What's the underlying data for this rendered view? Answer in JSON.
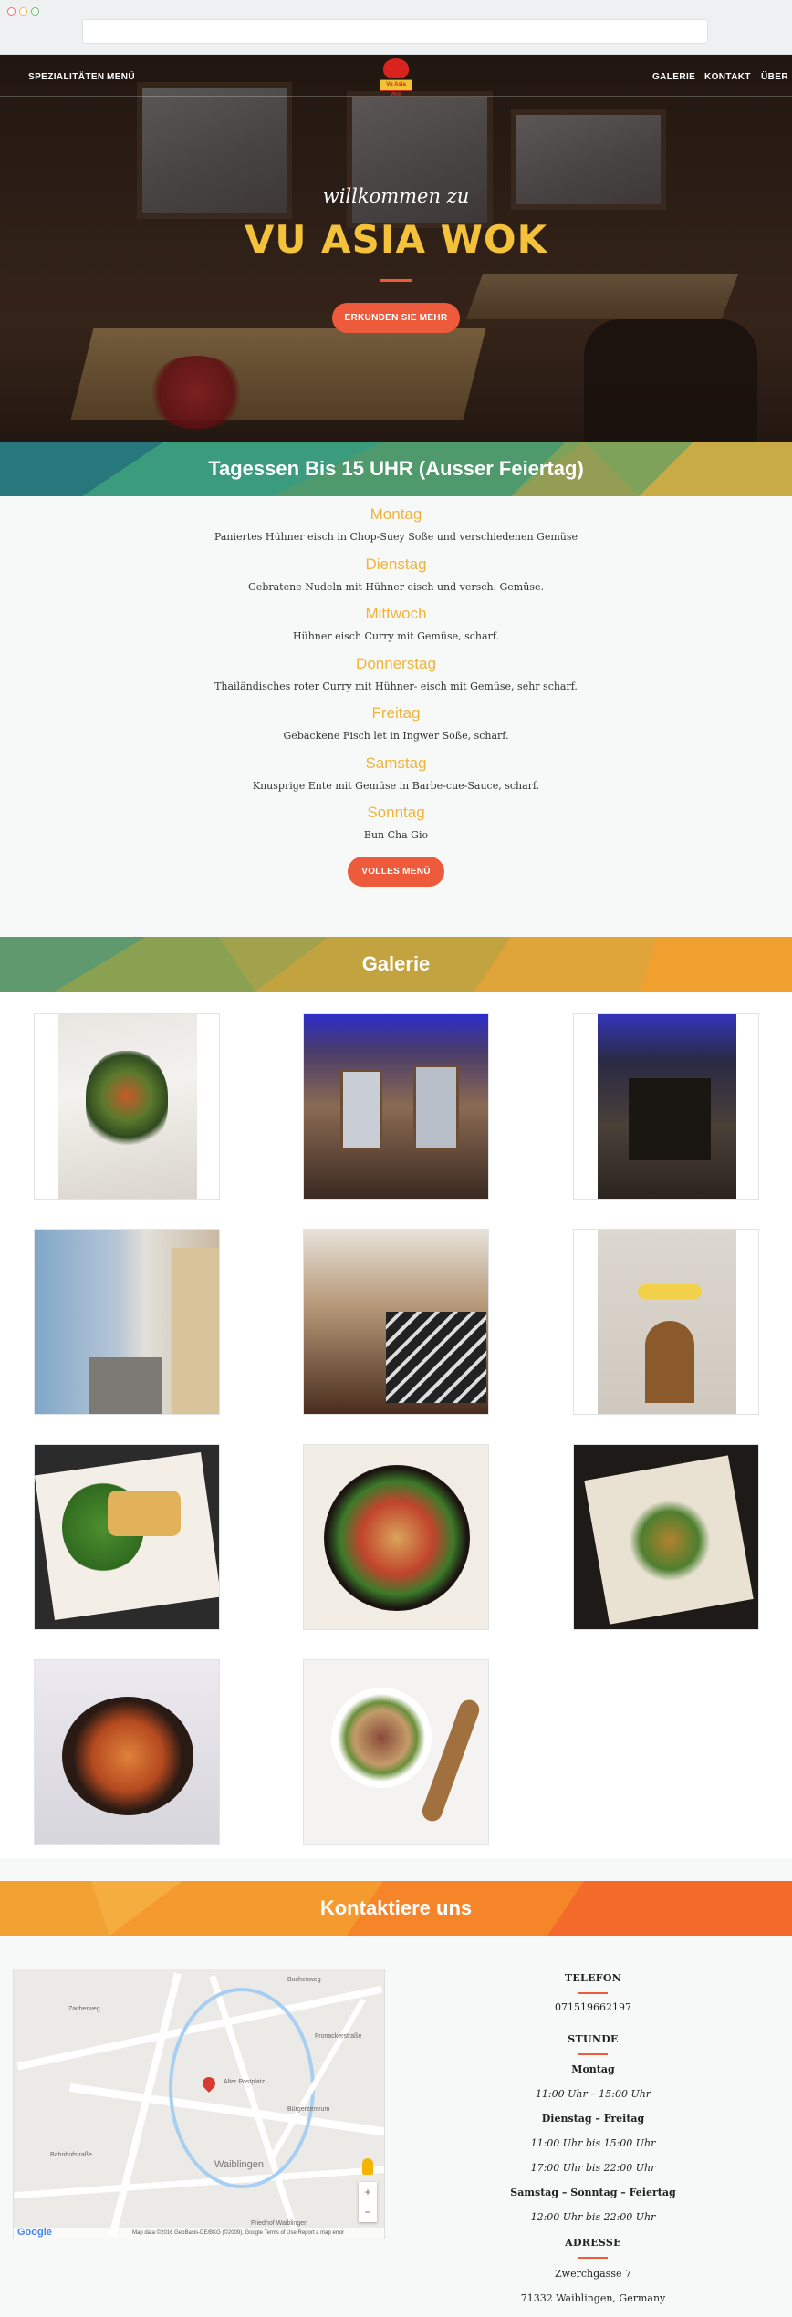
{
  "nav": {
    "left": [
      "SPEZIALITÄTEN",
      "MENÜ"
    ],
    "right": [
      "GALERIE",
      "KONTAKT",
      "ÜBER"
    ],
    "logo_text": "Vu Asia Wok"
  },
  "hero": {
    "welcome": "willkommen zu",
    "title": "VU ASIA WOK",
    "button": "ERKUNDEN SIE MEHR"
  },
  "lunch": {
    "heading": "Tagessen Bis 15 UHR (Ausser Feiertag)",
    "days": [
      {
        "day": "Montag",
        "dish": "Paniertes Hühner eisch in Chop-Suey Soße und verschiedenen Gemüse"
      },
      {
        "day": "Dienstag",
        "dish": "Gebratene Nudeln mit Hühner eisch und versch. Gemüse."
      },
      {
        "day": "Mittwoch",
        "dish": "Hühner eisch Curry mit Gemüse, scharf."
      },
      {
        "day": "Donnerstag",
        "dish": "Thailändisches roter Curry mit Hühner- eisch mit Gemüse, sehr scharf."
      },
      {
        "day": "Freitag",
        "dish": "Gebackene Fisch let in Ingwer Soße, scharf."
      },
      {
        "day": "Samstag",
        "dish": "Knusprige Ente mit Gemüse in Barbe-cue-Sauce, scharf."
      },
      {
        "day": "Sonntag",
        "dish": "Bun Cha Gio"
      }
    ],
    "button": "VOLLES MENÜ"
  },
  "gallery": {
    "heading": "Galerie",
    "photos": [
      "food-plate-1",
      "restaurant-interior-1",
      "restaurant-interior-2",
      "street-alley",
      "restaurant-tables",
      "restaurant-entrance",
      "spring-rolls",
      "stir-fry-bowl",
      "rice-paper-dish",
      "clay-pot-shrimp",
      "pho-soup"
    ]
  },
  "contact": {
    "heading": "Kontaktiere uns",
    "phone_label": "TELEFON",
    "phone": "071519662197",
    "hours_label": "STUNDE",
    "hours": [
      {
        "day": "Montag",
        "time": "11:00 Uhr – 15:00 Uhr"
      },
      {
        "day": "Dienstag – Freitag",
        "time": "11:00 Uhr bis 15:00 Uhr",
        "time2": "17:00 Uhr bis 22:00 Uhr"
      },
      {
        "day": "Samstag – Sonntag – Feiertag",
        "time": "12:00 Uhr bis 22:00 Uhr"
      }
    ],
    "address_label": "ADRESSE",
    "street": "Zwerchgasse 7",
    "city": "71332 Waiblingen, Germany"
  },
  "map": {
    "labels": [
      "Zacherweg",
      "Bahnhofstraße",
      "Waiblingen",
      "Bürgerzentrum",
      "Friedhof Waiblingen",
      "Buchenweg",
      "Alter Postplatz",
      "Fronackerstraße"
    ],
    "footer": "Map data ©2016 GeoBasis-DE/BKG (©2009), Google   Terms of Use   Report a map error",
    "google": "Google"
  },
  "colors": {
    "accent": "#ee5b3c",
    "gold": "#f4c23a",
    "day": "#f0b43a"
  }
}
